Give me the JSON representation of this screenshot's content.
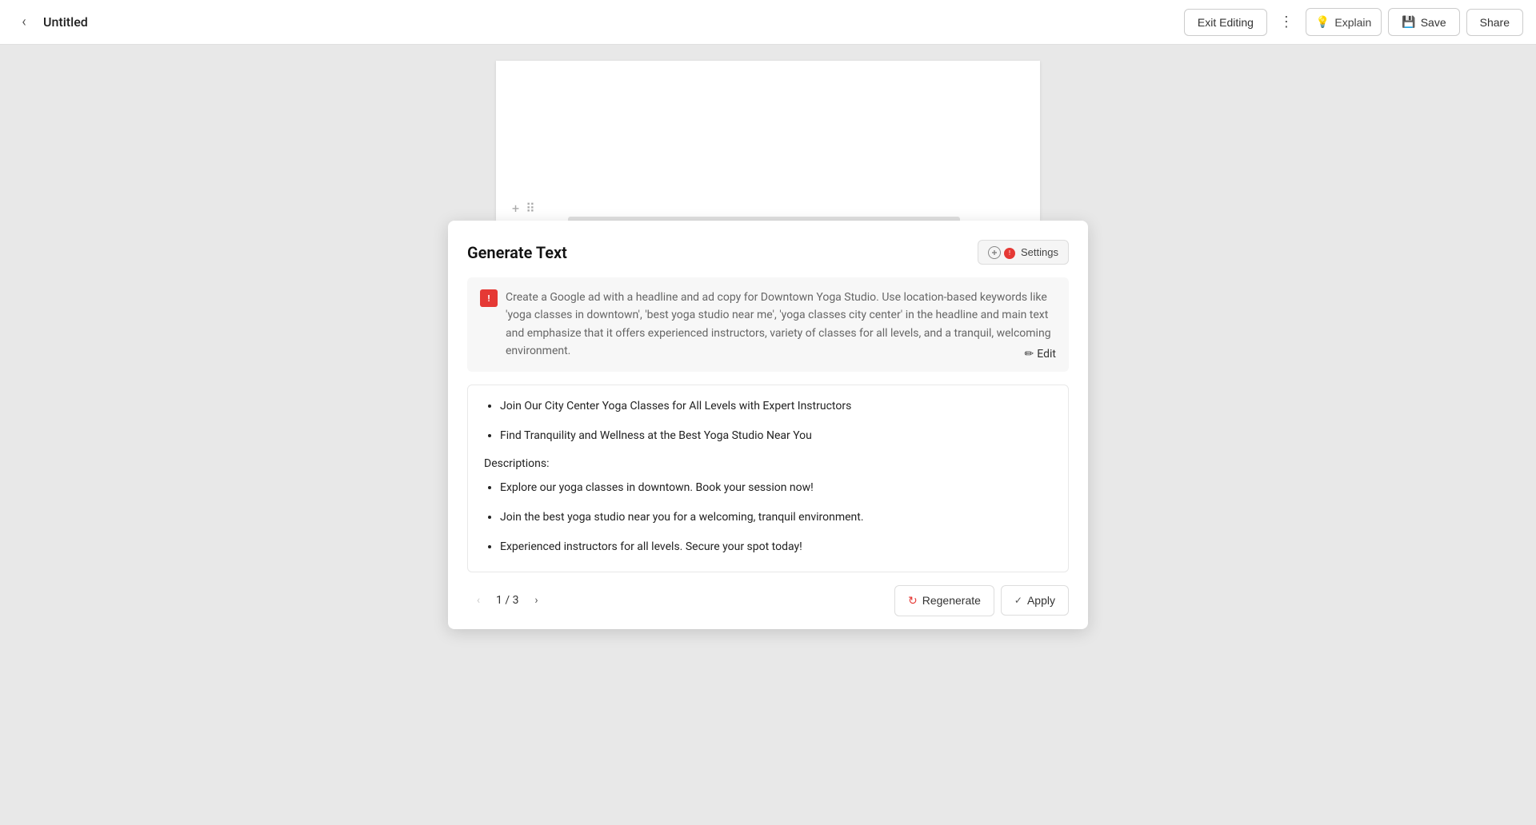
{
  "topbar": {
    "title": "Untitled",
    "exit_editing_label": "Exit Editing",
    "explain_label": "Explain",
    "save_label": "Save",
    "share_label": "Share",
    "more_icon": "⋮"
  },
  "modal": {
    "title": "Generate Text",
    "settings_label": "Settings",
    "edit_label": "Edit",
    "prompt_text": "Create a Google ad with a headline and ad copy for Downtown Yoga Studio. Use location-based keywords like 'yoga classes in downtown', 'best yoga studio near me', 'yoga classes city center' in the headline and main text and emphasize that it offers experienced instructors, variety of classes for all levels, and a tranquil, welcoming environment.",
    "results": {
      "headlines": [
        "Join Our City Center Yoga Classes for All Levels with Expert Instructors",
        "Find Tranquility and Wellness at the Best Yoga Studio Near You"
      ],
      "descriptions_title": "Descriptions:",
      "descriptions": [
        "Explore our yoga classes in downtown. Book your session now!",
        "Join the best yoga studio near you for a welcoming, tranquil environment.",
        "Experienced instructors for all levels. Secure your spot today!"
      ]
    },
    "pagination": {
      "current": "1",
      "separator": "/",
      "total": "3"
    },
    "regenerate_label": "Regenerate",
    "apply_label": "Apply"
  }
}
